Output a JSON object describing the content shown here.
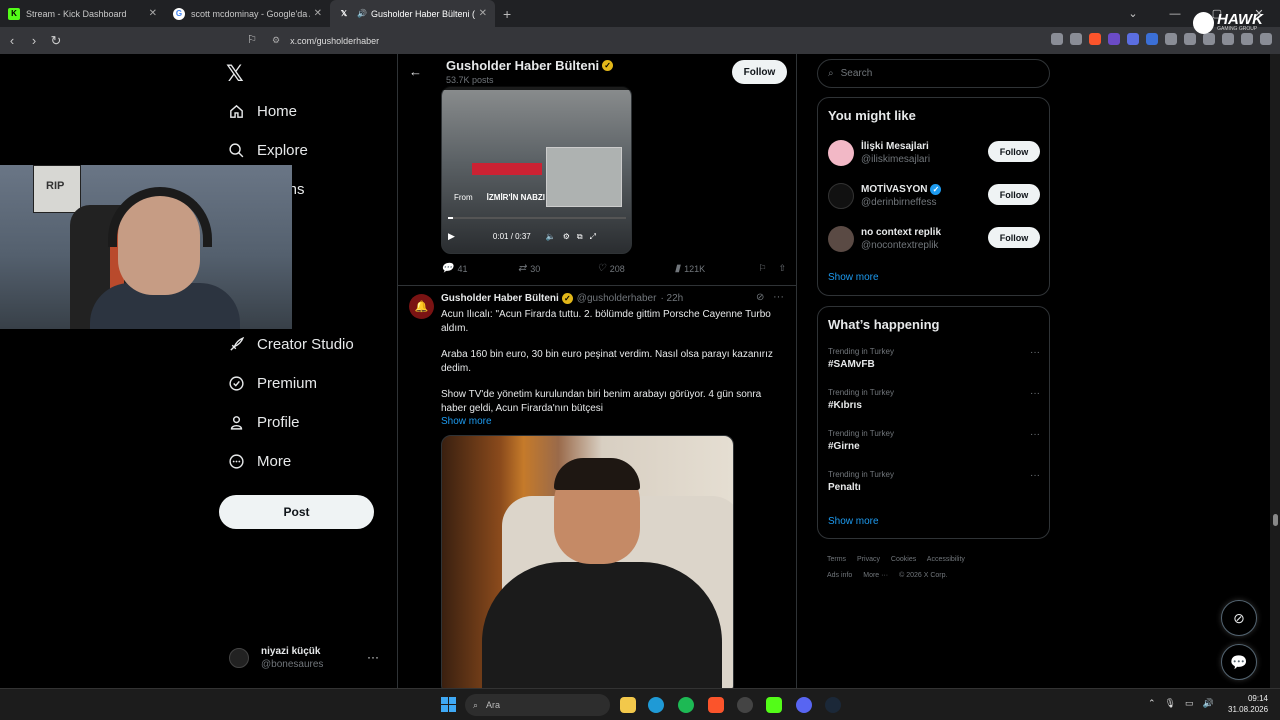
{
  "browser": {
    "tabs": [
      {
        "title": "Stream - Kick Dashboard",
        "active": false
      },
      {
        "title": "scott mcdominay - Google'da Ara",
        "active": false
      },
      {
        "title": "Gusholder Haber Bülteni (@g",
        "active": true
      }
    ],
    "url": "x.com/gusholderhaber"
  },
  "overlay": {
    "brand": "HAWK",
    "brand_sub": "GAMING GROUP"
  },
  "nav": {
    "logo": "𝕏",
    "items": [
      {
        "label": "Home"
      },
      {
        "label": "Explore"
      },
      {
        "label": "Notifications",
        "visible_part": "cations"
      },
      {
        "label": "History",
        "visible_part": "ry"
      },
      {
        "label": "Creator Studio"
      },
      {
        "label": "Premium"
      },
      {
        "label": "Profile"
      },
      {
        "label": "More"
      }
    ],
    "post_button": "Post",
    "user": {
      "name": "niyazi küçük",
      "handle": "@bonesaures"
    }
  },
  "profile_header": {
    "name": "Gusholder Haber Bülteni",
    "posts_count": "53.7K posts",
    "follow_label": "Follow"
  },
  "tweet1": {
    "video": {
      "source_prefix": "From",
      "source_name": "İZMİR'İN NABZI",
      "time": "0:01 / 0:37",
      "progress": 0.03
    },
    "stats": {
      "replies": "41",
      "reposts": "30",
      "likes": "208",
      "views": "121K"
    }
  },
  "tweet2": {
    "author": "Gusholder Haber Bülteni",
    "handle": "@gusholderhaber",
    "time": "· 22h",
    "paragraphs": [
      "Acun Ilıcalı: \"Acun Firarda tuttu. 2. bölümde gittim Porsche Cayenne Turbo aldım.",
      "Araba 160 bin euro, 30 bin euro peşinat verdim. Nasıl olsa parayı kazanırız dedim.",
      "Show TV'de yönetim kurulundan biri benim arabayı görüyor. 4 gün sonra haber geldi, Acun Firarda'nın bütçesi"
    ],
    "show_more": "Show more"
  },
  "right": {
    "search_placeholder": "Search",
    "you_might_like": {
      "title": "You might like",
      "users": [
        {
          "name": "İlişki Mesajlari",
          "handle": "@iliskimesajlari",
          "verified": false,
          "avatar_color": "#f2b8c6"
        },
        {
          "name": "MOTİVASYON",
          "handle": "@derinbirneffess",
          "verified": true,
          "avatar_color": "#111111"
        },
        {
          "name": "no context replik",
          "handle": "@nocontextreplik",
          "verified": false,
          "avatar_color": "#5a4a44"
        }
      ],
      "follow_label": "Follow",
      "show_more": "Show more"
    },
    "whats_happening": {
      "title": "What’s happening",
      "trends": [
        {
          "context": "Trending in Turkey",
          "topic": "#SAMvFB"
        },
        {
          "context": "Trending in Turkey",
          "topic": "#Kıbrıs"
        },
        {
          "context": "Trending in Turkey",
          "topic": "#Girne"
        },
        {
          "context": "Trending in Turkey",
          "topic": "Penaltı"
        }
      ],
      "show_more": "Show more"
    },
    "footer": [
      "Terms",
      "Privacy",
      "Cookies",
      "Accessibility",
      "Ads info",
      "More ···",
      "© 2026 X Corp."
    ]
  },
  "taskbar": {
    "search_placeholder": "Ara",
    "time": "09:14",
    "date": "31.08.2026"
  },
  "colors": {
    "accent": "#1d9bf0",
    "gold_badge": "#e2b719",
    "background": "#000000",
    "border": "#2f3336"
  }
}
